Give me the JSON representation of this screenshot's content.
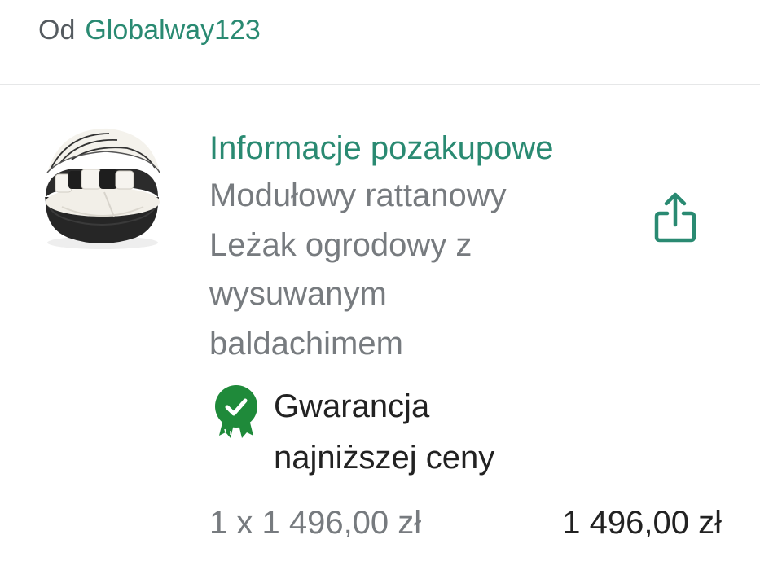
{
  "seller": {
    "prefix": "Od",
    "name": "Globalway123"
  },
  "order_item": {
    "section_link": "Informacje pozakupowe",
    "title_lines": [
      "Modułowy rattanowy",
      "Leżak ogrodowy z",
      "wysuwanym",
      "baldachimem"
    ],
    "thumbnail_icon": "rattan-daybed-image",
    "share_icon": "share-icon",
    "guarantee": {
      "icon": "guarantee-badge-icon",
      "lines": [
        "Gwarancja",
        "najniższej ceny"
      ]
    },
    "quantity_price": "1 x 1 496,00 zł",
    "total_price": "1 496,00 zł"
  },
  "colors": {
    "accent": "#2a8a72",
    "badge_green": "#1f8a3a",
    "text_primary": "#222222",
    "text_secondary": "#777b7f",
    "divider": "#e6e7e8"
  }
}
